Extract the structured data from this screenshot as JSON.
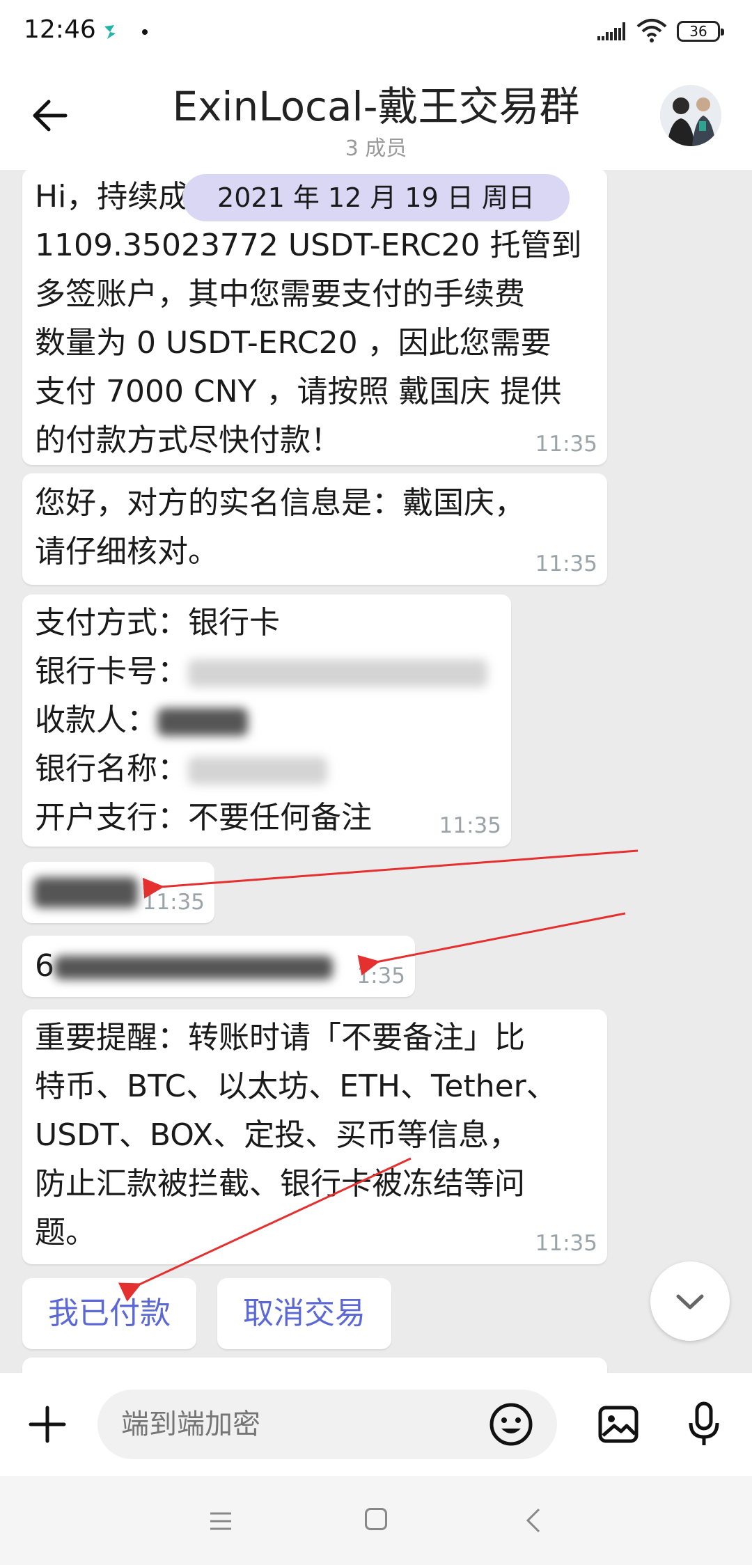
{
  "status_bar": {
    "time": "12:46",
    "battery": "36"
  },
  "header": {
    "title": "ExinLocal-戴王交易群",
    "subtitle": "3 成员"
  },
  "date_pill": "2021 年 12 月 19 日 周日",
  "messages": [
    {
      "lines": [
        "Hi，持续成",
        "1109.35023772 USDT-ERC20 托管到",
        "多签账户，其中您需要支付的手续费",
        "数量为 0 USDT-ERC20 ，因此您需要",
        "支付 7000 CNY ，请按照 戴国庆 提供",
        "的付款方式尽快付款！"
      ],
      "time": "11:35"
    },
    {
      "lines": [
        "您好，对方的实名信息是：戴国庆，",
        "请仔细核对。"
      ],
      "time": "11:35"
    },
    {
      "lines": [
        "支付方式：银行卡",
        "银行卡号：",
        "收款人：",
        "银行名称：",
        "开户支行：不要任何备注"
      ],
      "time": "11:35"
    },
    {
      "time": "11:35"
    },
    {
      "lines": [
        "6"
      ],
      "time": "1:35"
    },
    {
      "lines": [
        "重要提醒：转账时请「不要备注」比",
        "特币、BTC、以太坊、ETH、Tether、",
        "USDT、BOX、定投、买币等信息，",
        "防止汇款被拦截、银行卡被冻结等问",
        "题。"
      ],
      "time": "11:35"
    }
  ],
  "actions": {
    "paid": "我已付款",
    "cancel": "取消交易"
  },
  "input": {
    "placeholder": "端到端加密"
  },
  "colors": {
    "accent": "#5b68d6",
    "arrow": "#e53030",
    "date_pill": "#d9d7f4"
  },
  "icons": [
    "back-arrow-icon",
    "plus-icon",
    "emoji-icon",
    "image-icon",
    "microphone-icon",
    "chevron-down-icon"
  ]
}
